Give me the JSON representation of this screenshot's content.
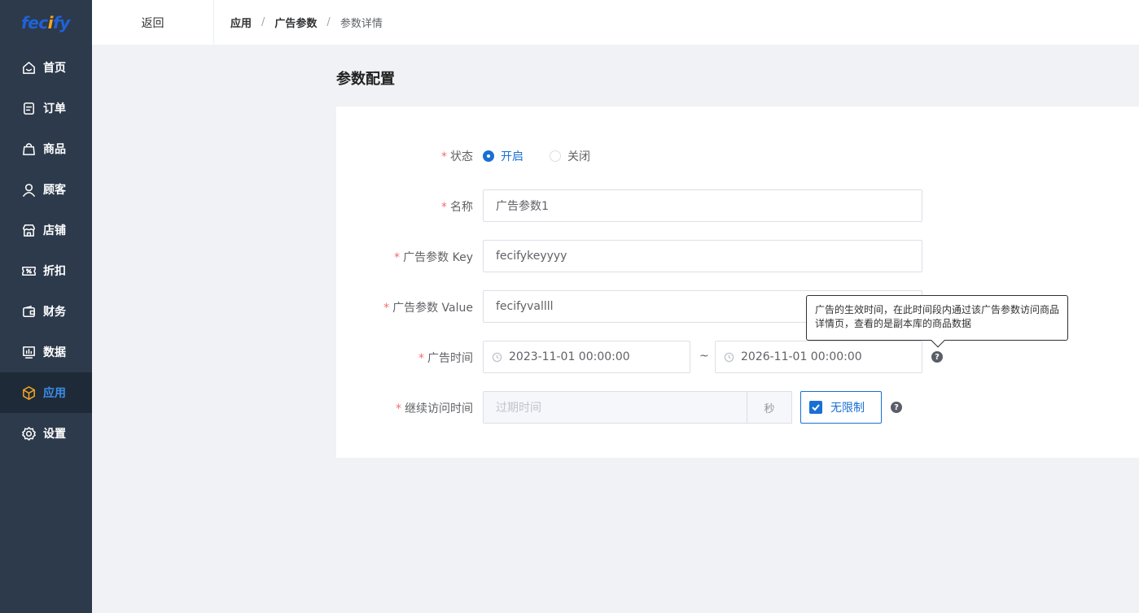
{
  "brand": {
    "logo_prefix": "fec",
    "logo_dot": "i",
    "logo_suffix": "fy",
    "accent": "#1e63d9",
    "logo_dot_color": "#f5a623"
  },
  "sidebar": {
    "items": [
      {
        "label": "首页",
        "icon": "home-icon"
      },
      {
        "label": "订单",
        "icon": "order-icon"
      },
      {
        "label": "商品",
        "icon": "bag-icon"
      },
      {
        "label": "顾客",
        "icon": "user-icon"
      },
      {
        "label": "店铺",
        "icon": "store-icon"
      },
      {
        "label": "折扣",
        "icon": "coupon-icon"
      },
      {
        "label": "财务",
        "icon": "wallet-icon"
      },
      {
        "label": "数据",
        "icon": "chart-icon"
      },
      {
        "label": "应用",
        "icon": "cube-icon",
        "active": true
      },
      {
        "label": "设置",
        "icon": "gear-icon"
      }
    ]
  },
  "header": {
    "back_label": "返回",
    "breadcrumb": [
      "应用",
      "广告参数",
      "参数详情"
    ]
  },
  "page": {
    "title": "参数配置"
  },
  "form": {
    "status": {
      "label": "状态",
      "options": [
        "开启",
        "关闭"
      ],
      "selected": "开启"
    },
    "name": {
      "label": "名称",
      "value": "广告参数1"
    },
    "key": {
      "label": "广告参数 Key",
      "value": "fecifykeyyyy"
    },
    "value": {
      "label": "广告参数 Value",
      "value": "fecifyvallll"
    },
    "time": {
      "label": "广告时间",
      "start": "2023-11-01 00:00:00",
      "separator": "~",
      "end": "2026-11-01 00:00:00"
    },
    "continue": {
      "label": "继续访问时间",
      "placeholder": "过期时间",
      "unit": "秒",
      "unlimited_label": "无限制",
      "unlimited_checked": true
    }
  },
  "tooltip": {
    "text": "广告的生效时间，在此时间段内通过该广告参数访问商品详情页，查看的是副本库的商品数据"
  },
  "colors": {
    "sidebar_bg": "#2d3a4b",
    "primary": "#1a6fd4",
    "required": "#f56c6c"
  }
}
